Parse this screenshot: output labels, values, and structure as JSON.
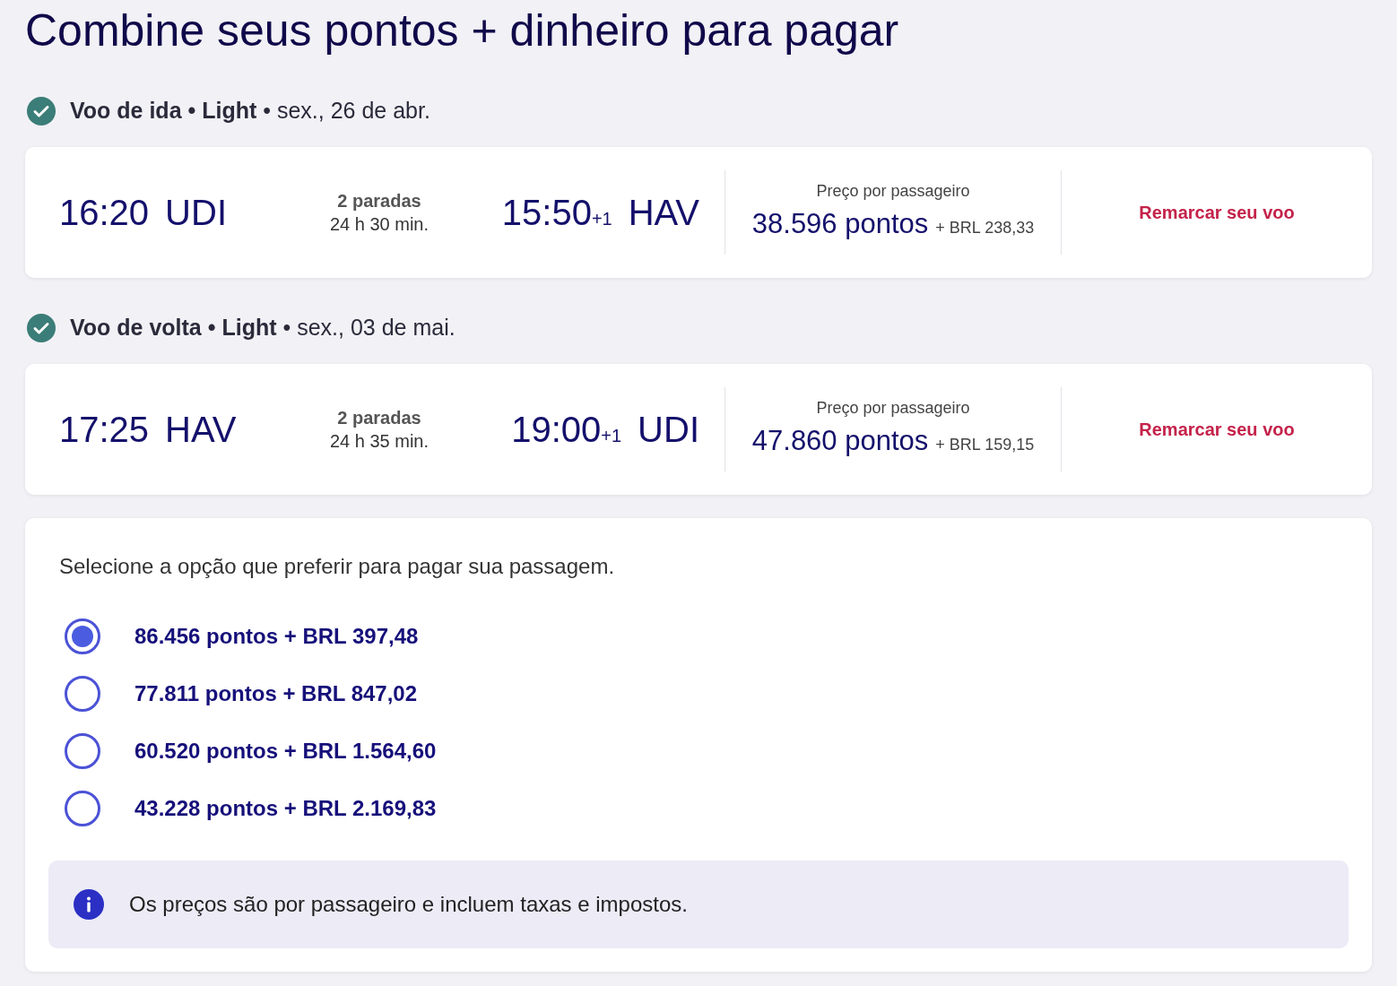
{
  "title": "Combine seus pontos + dinheiro para pagar",
  "flights": [
    {
      "heading": "**Voo de ida • Light** • sex., 26 de abr.",
      "confirmed": true,
      "departure_time": "16:20",
      "origin": "UDI",
      "stops": "2 paradas",
      "duration": "24 h 30 min.",
      "arrival_time": "15:50",
      "day_offset": "+1",
      "destination": "HAV",
      "price_label": "Preço por passageiro",
      "points": "38.596 pontos",
      "cash": "+ BRL 238,33",
      "action": "Remarcar seu voo"
    },
    {
      "heading": "**Voo de volta • Light** • sex., 03 de mai.",
      "confirmed": true,
      "departure_time": "17:25",
      "origin": "HAV",
      "stops": "2 paradas",
      "duration": "24 h 35 min.",
      "arrival_time": "19:00",
      "day_offset": "+1",
      "destination": "UDI",
      "price_label": "Preço por passageiro",
      "points": "47.860 pontos",
      "cash": "+ BRL 159,15",
      "action": "Remarcar seu voo"
    }
  ],
  "payment": {
    "prompt": "Selecione a opção que preferir para pagar sua passagem.",
    "options": [
      {
        "label": "86.456 pontos + BRL 397,48",
        "selected": true
      },
      {
        "label": "77.811 pontos + BRL 847,02",
        "selected": false
      },
      {
        "label": "60.520 pontos + BRL 1.564,60",
        "selected": false
      },
      {
        "label": "43.228 pontos + BRL 2.169,83",
        "selected": false
      }
    ],
    "info": "Os preços são por passageiro e incluem taxas e impostos."
  }
}
